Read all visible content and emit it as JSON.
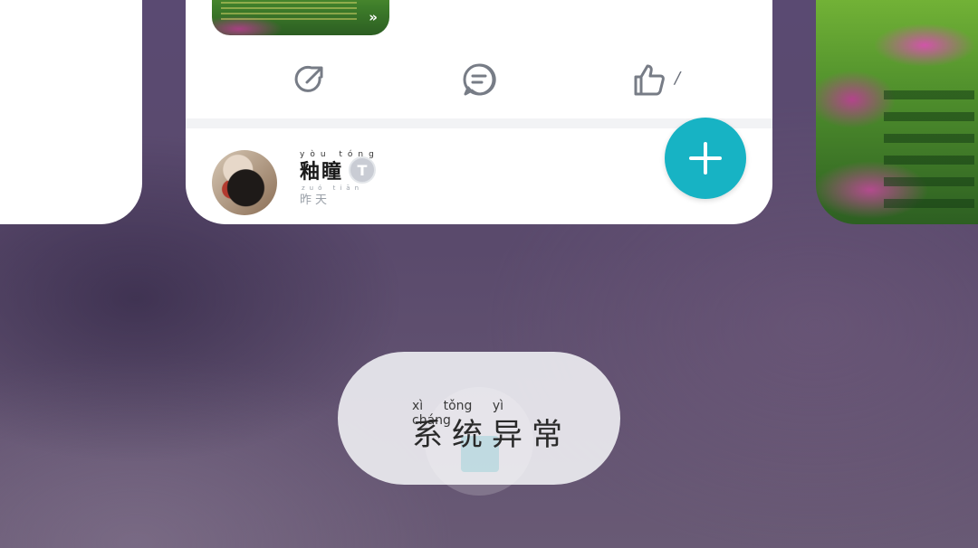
{
  "feed_card": {
    "thumbnail_overlay_icon": "skip-forward-icon",
    "actions": {
      "share_icon": "share-icon",
      "comment_icon": "comment-icon",
      "like_icon": "thumbs-up-icon",
      "like_count": "/"
    },
    "author": {
      "name": "釉瞳",
      "name_pinyin": "yòu tóng",
      "level_badge": "T",
      "time": "昨天",
      "time_pinyin": "zuó tiān"
    }
  },
  "fab": {
    "icon": "plus-icon",
    "color": "#17b3c4"
  },
  "toast": {
    "message": "系统异常",
    "pinyin": "xì tǒng yì cháng"
  },
  "background_icon": "trash-icon"
}
